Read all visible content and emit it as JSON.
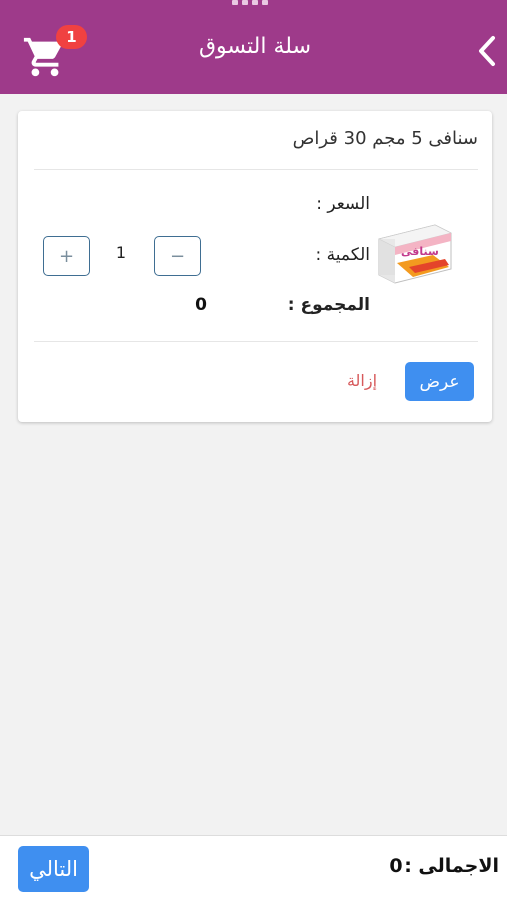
{
  "header": {
    "title": "سلة التسوق",
    "cart_count": "1",
    "back_icon": "chevron-left-icon",
    "cart_icon": "shopping-cart-icon",
    "background_color": "#9e3a8a"
  },
  "cart_item": {
    "title": "سنافى 5 مجم 30 قراص",
    "price_label": "السعر :",
    "quantity_label": "الكمية :",
    "quantity_value": "1",
    "total_label": "المجموع :",
    "total_value": "0",
    "decrease_label": "−",
    "increase_label": "+",
    "view_label": "عرض",
    "remove_label": "إزالة",
    "image_brand": "سنافى"
  },
  "footer": {
    "next_label": "التالي",
    "grand_total_label": "الاجمالى :",
    "grand_total_value": "0"
  },
  "colors": {
    "accent": "#3f8ff0",
    "remove": "#d7595b",
    "badge": "#f04141"
  }
}
